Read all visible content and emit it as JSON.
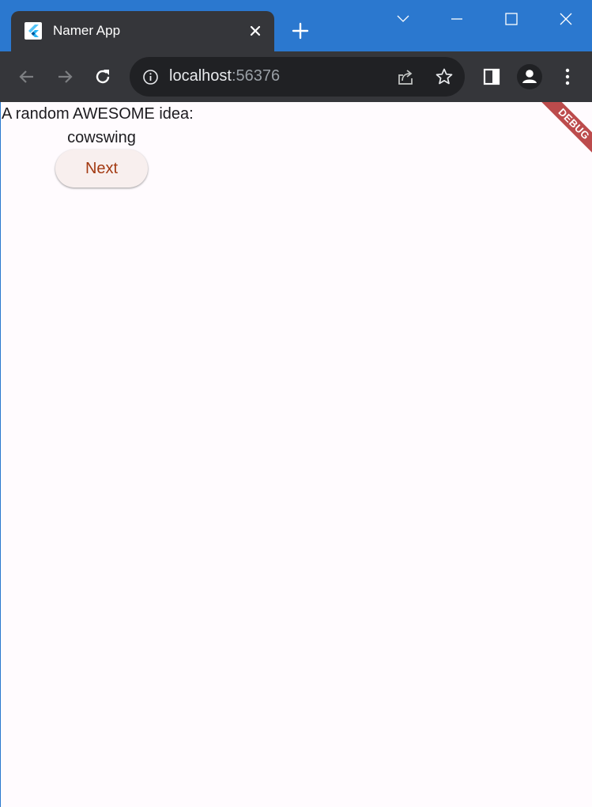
{
  "browser": {
    "tab": {
      "title": "Namer App",
      "favicon": "flutter-logo-icon",
      "close_icon": "close-icon"
    },
    "new_tab_icon": "plus-icon",
    "window_controls": [
      "chevron-down-icon",
      "minimize-icon",
      "maximize-icon",
      "close-icon"
    ],
    "toolbar": {
      "back_icon": "arrow-left-icon",
      "forward_icon": "arrow-right-icon",
      "reload_icon": "reload-icon",
      "site_info_icon": "info-icon",
      "url_host": "localhost",
      "url_port": ":56376",
      "share_icon": "share-icon",
      "bookmark_icon": "star-icon",
      "side_panel_icon": "side-panel-icon",
      "profile_icon": "profile-icon",
      "menu_icon": "kebab-menu-icon"
    },
    "colors": {
      "titlebar": "#2b78cf",
      "toolbar": "#35363a",
      "omnibox": "#202124"
    }
  },
  "app": {
    "caption": "A random AWESOME idea:",
    "word_pair": "cowswing",
    "next_button_label": "Next",
    "debug_banner": "DEBUG",
    "colors": {
      "background": "#fffbfe",
      "button_bg": "#f8efee",
      "button_text": "#a33a12"
    }
  }
}
